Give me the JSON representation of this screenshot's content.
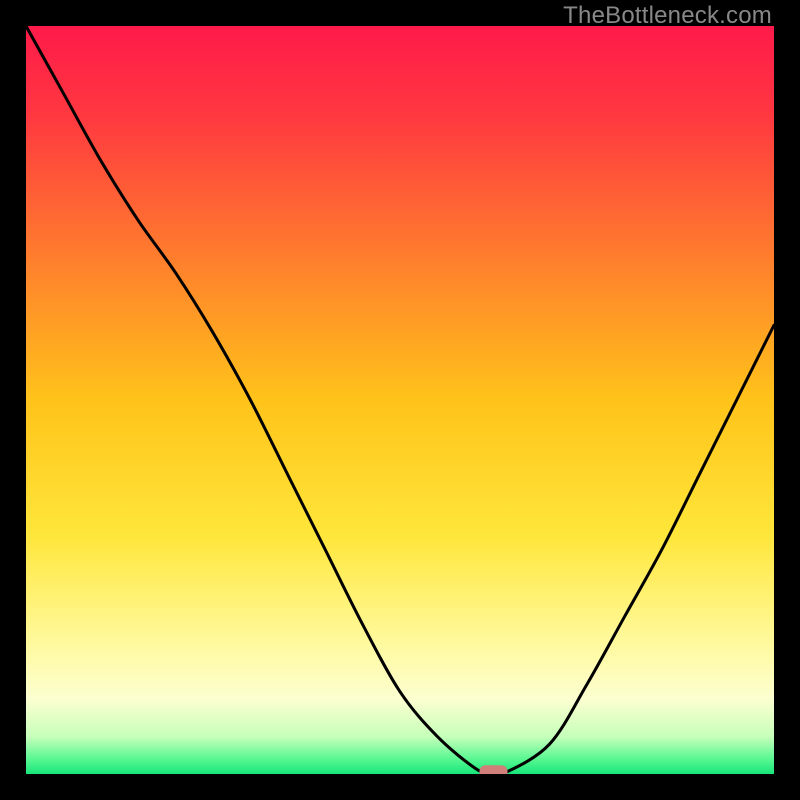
{
  "watermark": "TheBottleneck.com",
  "chart_data": {
    "type": "line",
    "title": "",
    "xlabel": "",
    "ylabel": "",
    "xlim": [
      0,
      100
    ],
    "ylim": [
      0,
      100
    ],
    "x": [
      0,
      5,
      10,
      15,
      20,
      25,
      30,
      35,
      40,
      45,
      50,
      55,
      60,
      62,
      64,
      70,
      75,
      80,
      85,
      90,
      95,
      100
    ],
    "values": [
      100,
      91,
      82,
      74,
      67,
      59,
      50,
      40,
      30,
      20,
      11,
      5,
      0.8,
      0.15,
      0.15,
      4,
      12,
      21,
      30,
      40,
      50,
      60
    ],
    "marker": {
      "x": 62.5,
      "y": 0.3,
      "color": "#d08078"
    },
    "gradient_stops": [
      {
        "pct": 0,
        "color": "#ff1a4a"
      },
      {
        "pct": 12,
        "color": "#ff3840"
      },
      {
        "pct": 30,
        "color": "#ff7a2e"
      },
      {
        "pct": 50,
        "color": "#ffc31a"
      },
      {
        "pct": 68,
        "color": "#ffe63a"
      },
      {
        "pct": 82,
        "color": "#fff99a"
      },
      {
        "pct": 90,
        "color": "#fcffd0"
      },
      {
        "pct": 95,
        "color": "#c6ffba"
      },
      {
        "pct": 98,
        "color": "#59f792"
      },
      {
        "pct": 100,
        "color": "#17e67a"
      }
    ],
    "curve_color": "#000000",
    "curve_width": 3
  }
}
